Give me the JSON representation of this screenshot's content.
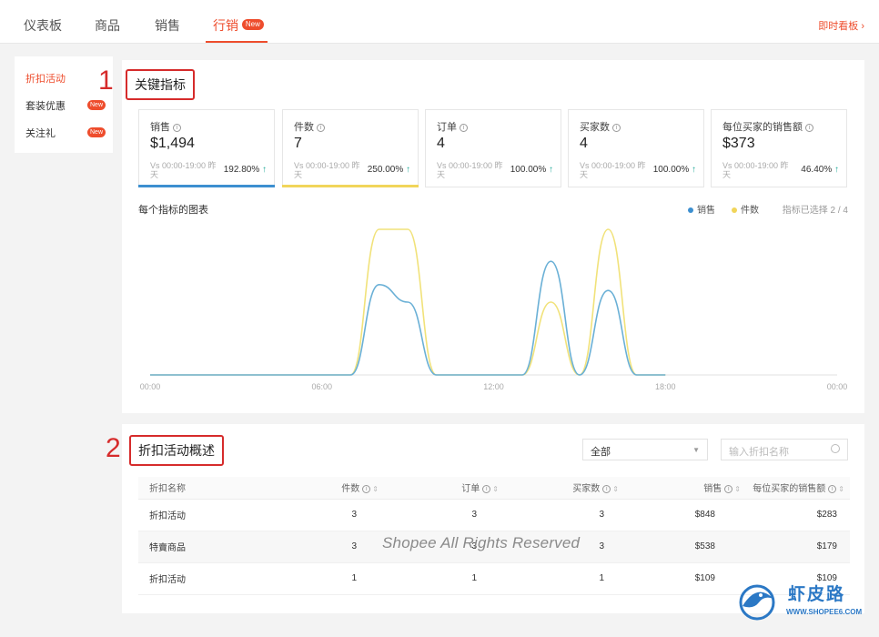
{
  "nav": {
    "tabs": [
      {
        "label": "仪表板"
      },
      {
        "label": "商品"
      },
      {
        "label": "销售"
      },
      {
        "label": "行销",
        "badge": "New"
      }
    ],
    "realtime_link": "即时看板 ›"
  },
  "sidebar": {
    "items": [
      {
        "label": "折扣活动"
      },
      {
        "label": "套装优惠",
        "badge": "New"
      },
      {
        "label": "关注礼",
        "badge": "New"
      }
    ]
  },
  "key_metrics": {
    "annotation_number": "1",
    "title": "关键指标",
    "cards": [
      {
        "label": "销售",
        "value": "$1,494",
        "vs": "Vs 00:00-19:00 昨天",
        "pct": "192.80%",
        "bar_color": "#3d8fd0"
      },
      {
        "label": "件数",
        "value": "7",
        "vs": "Vs 00:00-19:00 昨天",
        "pct": "250.00%",
        "bar_color": "#f1d55a"
      },
      {
        "label": "订单",
        "value": "4",
        "vs": "Vs 00:00-19:00 昨天",
        "pct": "100.00%",
        "bar_color": ""
      },
      {
        "label": "买家数",
        "value": "4",
        "vs": "Vs 00:00-19:00 昨天",
        "pct": "100.00%",
        "bar_color": ""
      },
      {
        "label": "每位买家的销售额",
        "value": "$373",
        "vs": "Vs 00:00-19:00 昨天",
        "pct": "46.40%",
        "bar_color": ""
      }
    ]
  },
  "chart_title": "每个指标的图表",
  "legend": {
    "sales": "销售",
    "units": "件数",
    "selected": "指标已选择 2 / 4"
  },
  "chart_data": {
    "type": "line",
    "x_ticks": [
      "00:00",
      "06:00",
      "12:00",
      "18:00",
      "00:00"
    ],
    "x": [
      "00:00",
      "01:00",
      "02:00",
      "03:00",
      "04:00",
      "05:00",
      "06:00",
      "07:00",
      "08:00",
      "09:00",
      "10:00",
      "11:00",
      "12:00",
      "13:00",
      "14:00",
      "15:00",
      "16:00",
      "17:00",
      "18:00"
    ],
    "ylim": [
      0,
      1
    ],
    "series": [
      {
        "name": "销售",
        "color": "#6ab0d6",
        "values": [
          0,
          0,
          0,
          0,
          0,
          0,
          0,
          0,
          0.62,
          0.5,
          0,
          0,
          0,
          0,
          0.78,
          0,
          0.58,
          0,
          0
        ]
      },
      {
        "name": "件数",
        "color": "#f1e27a",
        "values": [
          0,
          0,
          0,
          0,
          0,
          0,
          0,
          0,
          1,
          1,
          0,
          0,
          0,
          0,
          0.5,
          0,
          1,
          0,
          0
        ]
      }
    ],
    "grid": false,
    "legend_position": "top-right"
  },
  "discount_overview": {
    "annotation_number": "2",
    "title": "折扣活动概述",
    "filter_value": "全部",
    "search_placeholder": "输入折扣名称",
    "columns": [
      "折扣名称",
      "件数",
      "订单",
      "买家数",
      "销售",
      "每位买家的销售额"
    ],
    "rows": [
      [
        "折扣活动",
        "3",
        "3",
        "3",
        "$848",
        "$283"
      ],
      [
        "特賣商品",
        "3",
        "3",
        "3",
        "$538",
        "$179"
      ],
      [
        "折扣活动",
        "1",
        "1",
        "1",
        "$109",
        "$109"
      ]
    ]
  },
  "watermark": "Shopee All Rights Reserved",
  "logo": {
    "zh": "虾皮路",
    "en": "WWW.SHOPEE6.COM"
  }
}
